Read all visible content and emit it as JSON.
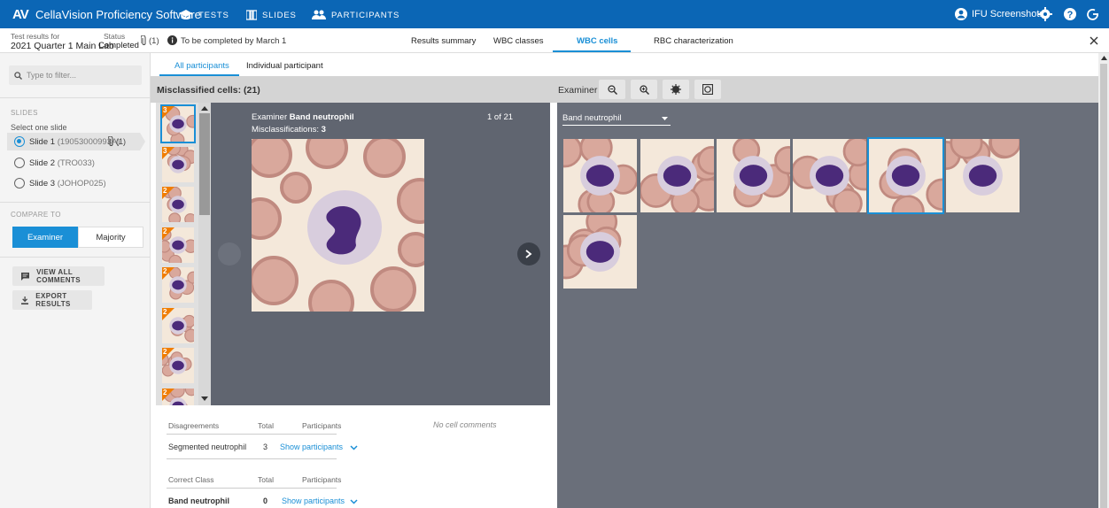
{
  "app": {
    "logo": "AV",
    "title": "CellaVision Proficiency Software"
  },
  "nav": [
    {
      "label": "TESTS",
      "icon": "graduation-cap-icon"
    },
    {
      "label": "SLIDES",
      "icon": "slides-icon"
    },
    {
      "label": "PARTICIPANTS",
      "icon": "people-icon"
    }
  ],
  "user": {
    "name": "IFU Screenshots"
  },
  "header": {
    "test_label": "Test results for",
    "test_name": "2021 Quarter 1 Main Lab",
    "status_label": "Status",
    "status_value": "Completed",
    "attachments": "(1)",
    "due_text": "To be completed by March 1"
  },
  "tabs": [
    "Results summary",
    "WBC classes",
    "WBC cells",
    "RBC characterization"
  ],
  "active_tab": "WBC cells",
  "subtabs": [
    "All participants",
    "Individual participant"
  ],
  "sidebar": {
    "search_placeholder": "Type to filter...",
    "slides_heading": "SLIDES",
    "select_label": "Select one slide",
    "slides": [
      {
        "name": "Slide 1",
        "code": "(19053000993A)",
        "attach": "(1)",
        "selected": true
      },
      {
        "name": "Slide 2",
        "code": "(TRO033)",
        "selected": false
      },
      {
        "name": "Slide 3",
        "code": "(JOHOP025)",
        "selected": false
      }
    ],
    "compare_heading": "COMPARE TO",
    "compare_options": [
      "Examiner",
      "Majority"
    ],
    "view_comments": "VIEW ALL COMMENTS",
    "export": "EXPORT RESULTS"
  },
  "misclassified": "Misclassified cells: (21)",
  "thumb_badges": [
    "3",
    "3",
    "2",
    "2",
    "2",
    "2",
    "2",
    "2"
  ],
  "detail": {
    "examiner_prefix": "Examiner",
    "examiner_class": "Band neutrophil",
    "misclass_prefix": "Misclassifications:",
    "misclass_count": "3",
    "counter": "1 of 21"
  },
  "examiner_bar": {
    "label": "Examiner"
  },
  "class_select": "Band neutrophil",
  "comments": "No cell comments",
  "disagreements": {
    "headers": [
      "Disagreements",
      "Total",
      "Participants"
    ],
    "rows": [
      {
        "class": "Segmented neutrophil",
        "total": "3",
        "link": "Show participants"
      }
    ]
  },
  "correct": {
    "headers": [
      "Correct Class",
      "Total",
      "Participants"
    ],
    "rows": [
      {
        "class": "Band neutrophil",
        "total": "0",
        "link": "Show participants"
      }
    ]
  },
  "colors": {
    "brand": "#0b66b5",
    "accent": "#1a8fd6",
    "badge": "#f07d00"
  }
}
